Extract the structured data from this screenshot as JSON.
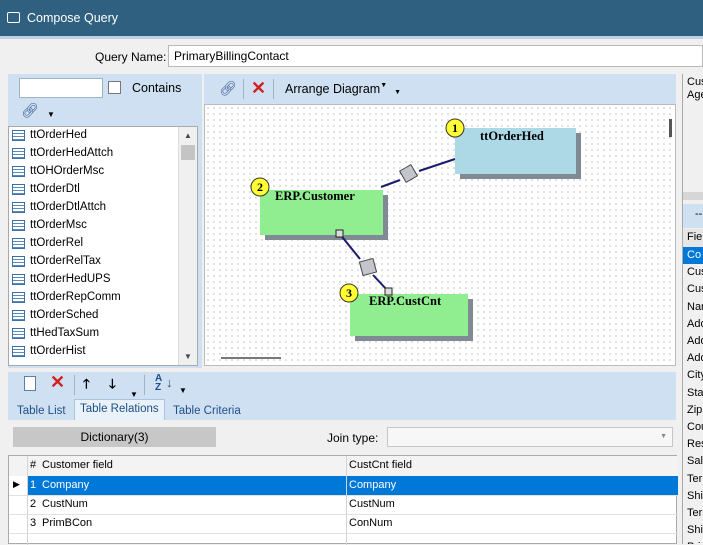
{
  "window": {
    "title": "Compose Query"
  },
  "query": {
    "name_label": "Query Name:",
    "name_value": "PrimaryBillingContact"
  },
  "left_panel": {
    "contains_label": "Contains",
    "search_value": "",
    "tables": [
      "ttOrderHed",
      "ttOrderHedAttch",
      "ttOHOrderMsc",
      "ttOrderDtl",
      "ttOrderDtlAttch",
      "ttOrderMsc",
      "ttOrderRel",
      "ttOrderRelTax",
      "ttOrderHedUPS",
      "ttOrderRepComm",
      "ttOrderSched",
      "ttHedTaxSum",
      "ttOrderHist"
    ]
  },
  "diagram_toolbar": {
    "arrange_label": "Arrange Diagram"
  },
  "diagram": {
    "tables": [
      {
        "number": "1",
        "name": "ttOrderHed"
      },
      {
        "number": "2",
        "name": "ERP.Customer"
      },
      {
        "number": "3",
        "name": "ERP.CustCnt"
      }
    ]
  },
  "tabs": [
    "Table List",
    "Table Relations",
    "Table Criteria"
  ],
  "active_tab": "Table Relations",
  "relations": {
    "dictionary_label": "Dictionary(3)",
    "join_type_label": "Join type:",
    "join_type_value": "",
    "columns": [
      "#",
      "Customer field",
      "CustCnt field"
    ],
    "rows": [
      {
        "num": "1",
        "left": "Company",
        "right": "Company"
      },
      {
        "num": "2",
        "left": "CustNum",
        "right": "CustNum"
      },
      {
        "num": "3",
        "left": "PrimBCon",
        "right": "ConNum"
      }
    ]
  },
  "right_strip": {
    "top_text": [
      "Cus",
      "Age"
    ],
    "header": "Fiel",
    "items": [
      "Co",
      "Cus",
      "Cus",
      "Nar",
      "Ado",
      "Ado",
      "Ado",
      "City",
      "Sta",
      "Zip",
      "Cou",
      "Res",
      "Sal",
      "Ter",
      "Shi",
      "Ter",
      "Shi",
      "Prin"
    ]
  },
  "colors": {
    "title_bar": "#2f607f",
    "panel": "#cfe0f3",
    "selection": "#0078d7",
    "table_blue": "#add8e6",
    "table_green": "#90ee90"
  }
}
